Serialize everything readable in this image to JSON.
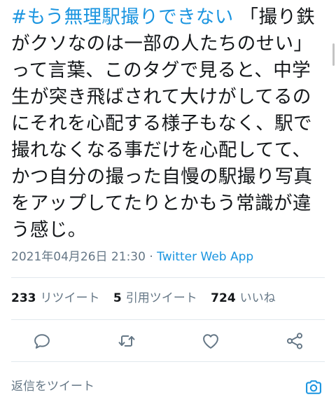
{
  "tweet": {
    "hashtag": "#もう無理駅撮りできない",
    "text": " 「撮り鉄がクソなのは一部の人たちのせい」って言葉、このタグで見ると、中学生が突き飛ばされて大けがしてるのにそれを心配する様子もなく、駅で撮れなくなる事だけを心配してて、かつ自分の撮った自慢の駅撮り写真をアップしてたりとかもう常識が違う感じ。",
    "timestamp": "2021年04月26日 21:30",
    "separator": " · ",
    "source": "Twitter Web App"
  },
  "stats": {
    "retweets": {
      "count": "233",
      "label": "リツイート"
    },
    "quotes": {
      "count": "5",
      "label": "引用ツイート"
    },
    "likes": {
      "count": "724",
      "label": "いいね"
    }
  },
  "actions": [
    {
      "icon": "reply-icon"
    },
    {
      "icon": "retweet-icon"
    },
    {
      "icon": "like-icon"
    },
    {
      "icon": "share-icon"
    }
  ],
  "reply": {
    "placeholder": "返信をツイート",
    "camera_icon": "camera-icon"
  },
  "colors": {
    "accent": "#1b95e0",
    "secondary_text": "#657786",
    "primary_text": "#14171a",
    "divider": "#e1e8ed"
  }
}
